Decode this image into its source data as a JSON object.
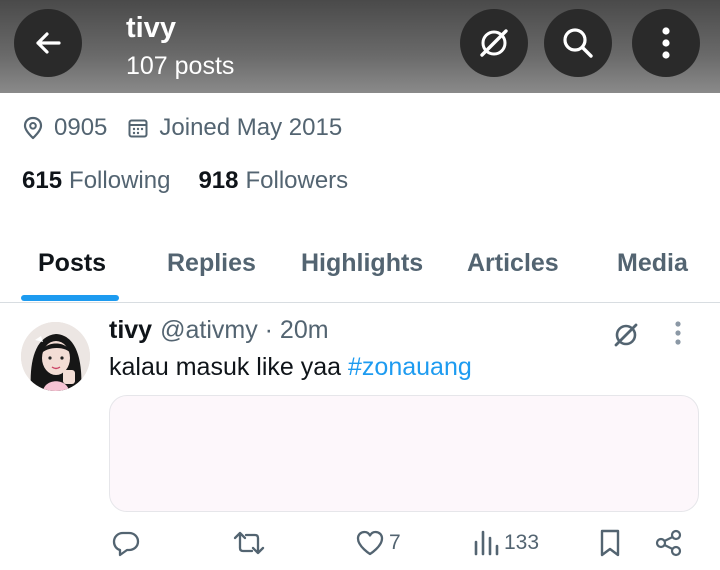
{
  "header": {
    "title": "tivy",
    "subtitle": "107 posts",
    "icons": [
      "back-arrow-icon",
      "grok-icon",
      "search-icon",
      "more-vertical-icon"
    ]
  },
  "profile": {
    "location": "0905",
    "joined": "Joined May 2015",
    "following_count": "615",
    "following_label": "Following",
    "followers_count": "918",
    "followers_label": "Followers"
  },
  "tabs": [
    {
      "label": "Posts",
      "active": true
    },
    {
      "label": "Replies",
      "active": false
    },
    {
      "label": "Highlights",
      "active": false
    },
    {
      "label": "Articles",
      "active": false
    },
    {
      "label": "Media",
      "active": false
    }
  ],
  "post": {
    "name": "tivy",
    "handle_time": "@ativmy · 20m",
    "text": "kalau masuk like yaa ",
    "hashtag": "#zonauang",
    "likes": "7",
    "views": "133"
  },
  "colors": {
    "accent": "#1d9bf0",
    "secondary_text": "#536471",
    "primary_text": "#0f1419"
  }
}
